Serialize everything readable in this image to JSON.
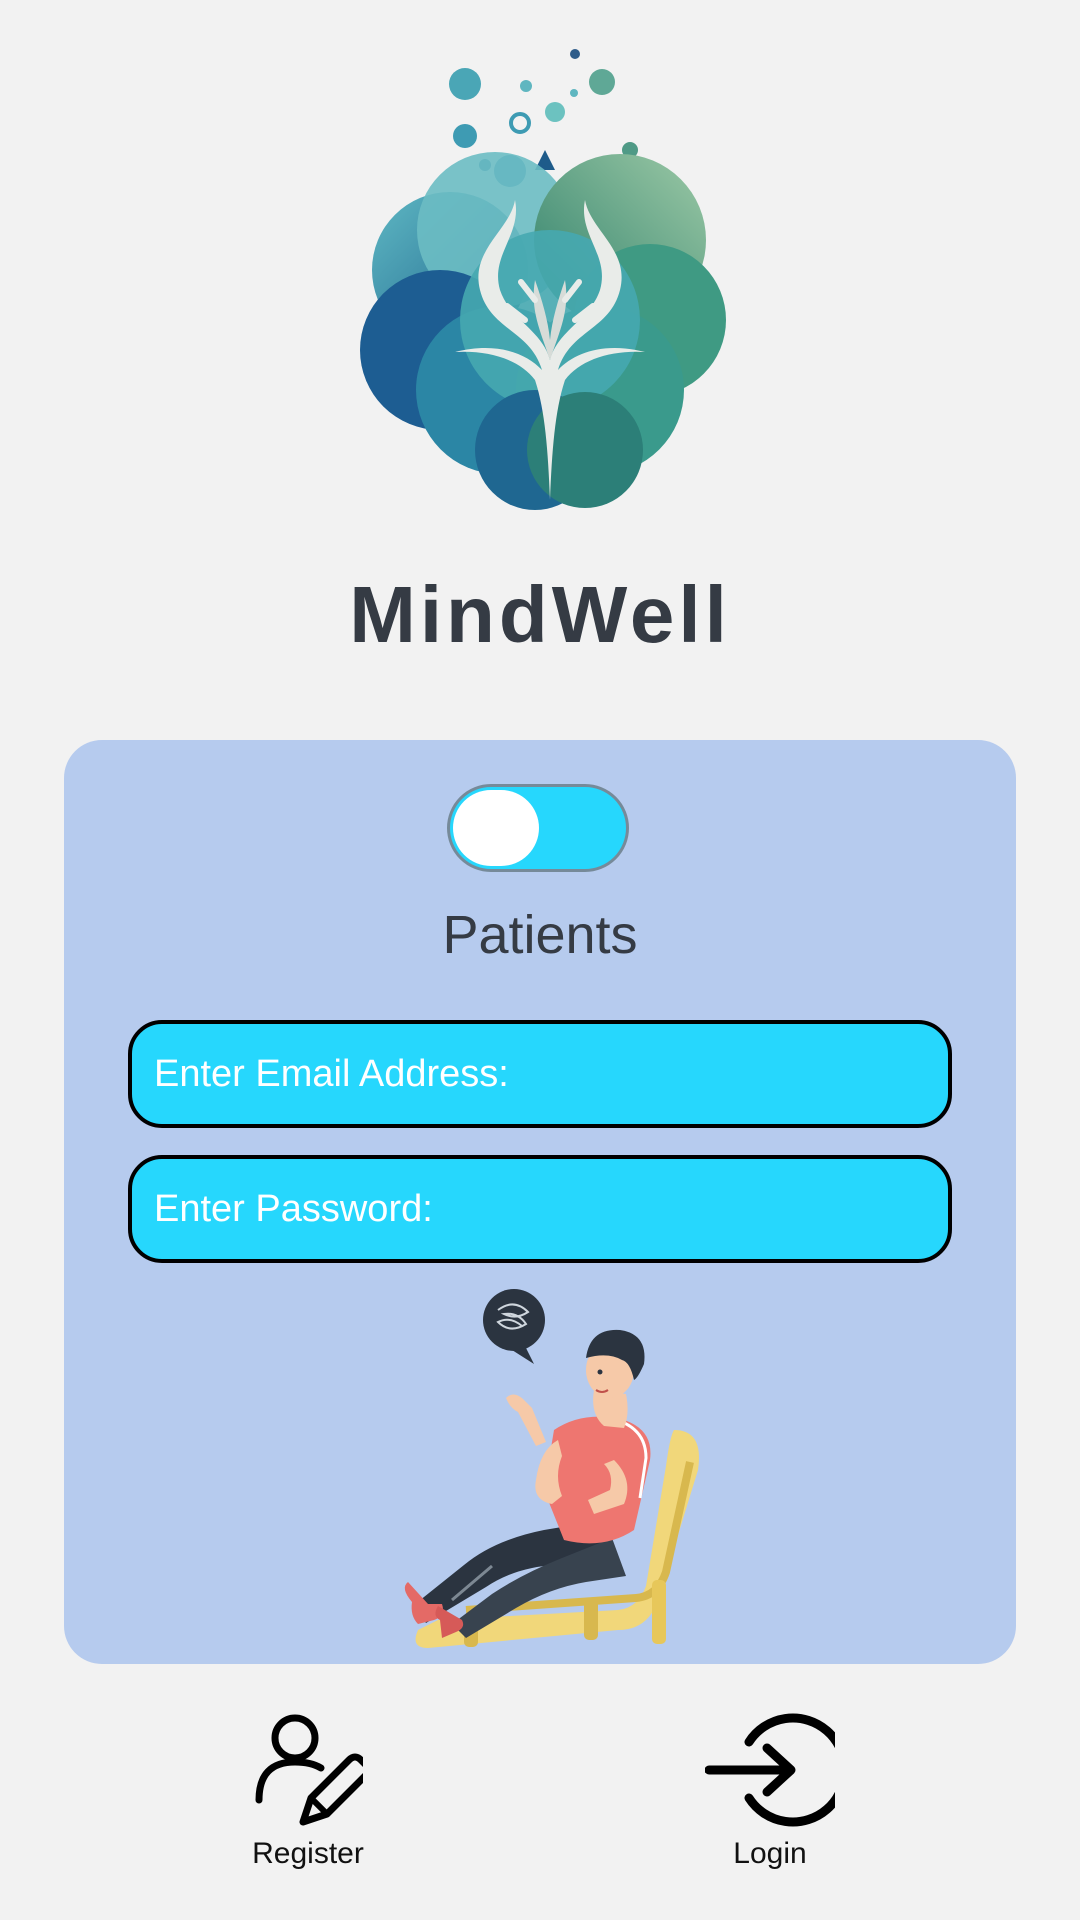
{
  "app": {
    "title": "MindWell"
  },
  "logo": {
    "icon": "tree-brain-logo"
  },
  "login_card": {
    "role_toggle": {
      "icon": "toggle-switch",
      "state": "off"
    },
    "role_label": "Patients",
    "email_field": {
      "placeholder": "Enter Email Address:",
      "value": ""
    },
    "password_field": {
      "placeholder": "Enter Password:",
      "value": ""
    },
    "illustration": {
      "icon": "patient-reclining-illustration"
    }
  },
  "bottom_nav": {
    "register": {
      "label": "Register",
      "icon": "user-edit-icon"
    },
    "login": {
      "label": "Login",
      "icon": "login-arrow-icon"
    }
  },
  "colors": {
    "background": "#f2f2f2",
    "card": "#b6cbee",
    "accent": "#26d7fd",
    "title_text": "#353b44"
  }
}
